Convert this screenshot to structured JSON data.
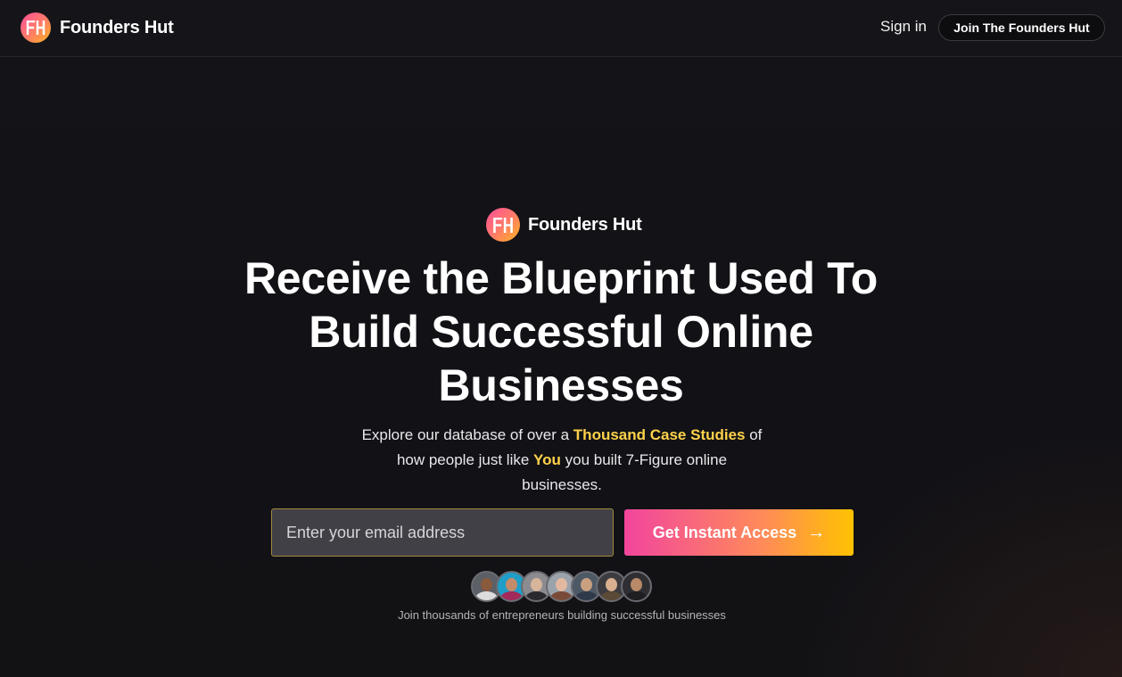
{
  "colors": {
    "background": "#111116",
    "accent_highlight": "#ffd24a",
    "cta_gradient_start": "#f2459d",
    "cta_gradient_end": "#ffc200"
  },
  "header": {
    "logo_icon": "founders-hut-logo-icon",
    "logo_mark": "FH",
    "brand_name": "Founders Hut",
    "sign_in_label": "Sign in",
    "join_label": "Join The Founders Hut"
  },
  "hero": {
    "brand_name": "Founders Hut",
    "headline_line1": "Receive the Blueprint Used To",
    "headline_line2": "Build Successful Online",
    "headline_line3": "Businesses",
    "sub_1": "Explore our database of over a ",
    "sub_hl_1": "Thousand Case Studies",
    "sub_2": " of how people just like ",
    "sub_hl_2": "You",
    "sub_3": " you built 7-Figure online businesses.",
    "email_placeholder": "Enter your email address",
    "email_value": "",
    "cta_label": "Get Instant Access",
    "cta_icon": "arrow-right-icon",
    "cta_arrow": "→",
    "avatars": [
      {
        "name": "avatar-1",
        "skin": "#8a5a3c",
        "shirt": "#dcdcdc",
        "bg": "#5b5f66"
      },
      {
        "name": "avatar-2",
        "skin": "#c48b6a",
        "shirt": "#a32a5a",
        "bg": "#1f9ec7"
      },
      {
        "name": "avatar-3",
        "skin": "#d7b59a",
        "shirt": "#2a2a2e",
        "bg": "#8c8c90"
      },
      {
        "name": "avatar-4",
        "skin": "#e2b9a0",
        "shirt": "#7a4a38",
        "bg": "#9aa2ab"
      },
      {
        "name": "avatar-5",
        "skin": "#c9a080",
        "shirt": "#2e3a4a",
        "bg": "#4d5965"
      },
      {
        "name": "avatar-6",
        "skin": "#d9b090",
        "shirt": "#5a4a36",
        "bg": "#3b3b40"
      },
      {
        "name": "avatar-7",
        "skin": "#b88a68",
        "shirt": "#1f1f22",
        "bg": "#2f2f33"
      }
    ],
    "social_proof": "Join thousands of entrepreneurs building successful businesses"
  }
}
